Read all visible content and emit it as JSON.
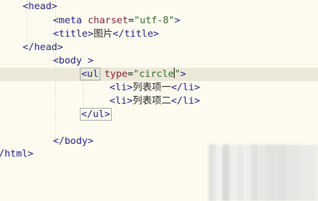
{
  "editor": {
    "lines": [
      {
        "indent": 35,
        "tokens": [
          {
            "c": "tag",
            "t": "<head>"
          }
        ]
      },
      {
        "indent": 75,
        "tokens": [
          {
            "c": "tag",
            "t": "<meta "
          },
          {
            "c": "attr",
            "t": "charset"
          },
          {
            "c": "plain",
            "t": "="
          },
          {
            "c": "str",
            "t": "\"utf-8\""
          },
          {
            "c": "tag",
            "t": ">"
          }
        ]
      },
      {
        "indent": 75,
        "tokens": [
          {
            "c": "tag",
            "t": "<title>"
          },
          {
            "c": "plain",
            "t": "图片"
          },
          {
            "c": "tag",
            "t": "</title>"
          }
        ]
      },
      {
        "indent": 35,
        "tokens": [
          {
            "c": "tag",
            "t": "</head>"
          }
        ]
      },
      {
        "indent": 75,
        "tokens": [
          {
            "c": "tag",
            "t": "<body >"
          }
        ]
      },
      {
        "indent": 115,
        "active": true,
        "tokens": [
          {
            "c": "tag hl",
            "t": "<ul"
          },
          {
            "c": "plain",
            "t": " "
          },
          {
            "c": "attr",
            "t": "type"
          },
          {
            "c": "plain",
            "t": "="
          },
          {
            "c": "str",
            "t": "\"circle"
          },
          {
            "c": "caret",
            "t": ""
          },
          {
            "c": "str",
            "t": "\""
          },
          {
            "c": "tag",
            "t": ">"
          }
        ]
      },
      {
        "indent": 155,
        "tokens": [
          {
            "c": "tag",
            "t": "<li>"
          },
          {
            "c": "plain",
            "t": "列表项一"
          },
          {
            "c": "tag",
            "t": "</li>"
          }
        ]
      },
      {
        "indent": 155,
        "tokens": [
          {
            "c": "tag",
            "t": "<li>"
          },
          {
            "c": "plain",
            "t": "列表项二"
          },
          {
            "c": "tag",
            "t": "</li>"
          }
        ]
      },
      {
        "indent": 115,
        "tokens": [
          {
            "c": "tag hl",
            "t": "</ul>"
          }
        ]
      },
      {
        "indent": 0,
        "tokens": []
      },
      {
        "indent": 75,
        "tokens": [
          {
            "c": "tag",
            "t": "</body>"
          }
        ]
      },
      {
        "indent": 0,
        "tokens": [
          {
            "c": "tag",
            "t": "</html>"
          }
        ]
      }
    ]
  }
}
